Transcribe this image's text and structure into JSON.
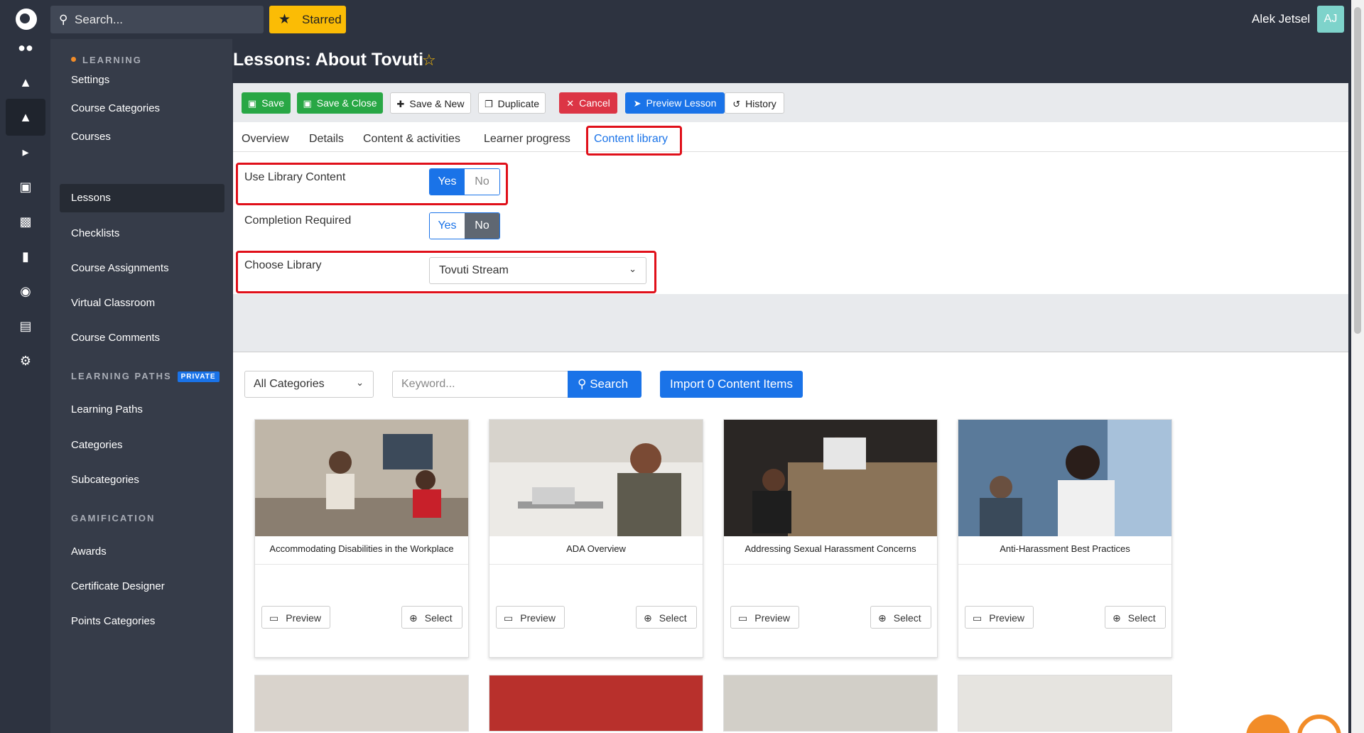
{
  "topbar": {
    "search_placeholder": "Search...",
    "starred_label": "Starred",
    "user_name": "Alek Jetsel",
    "avatar_initials": "AJ"
  },
  "rail": [
    "users-icon",
    "shapes-icon",
    "graduation-cap-icon",
    "megaphone-icon",
    "money-icon",
    "chart-icon",
    "chat-icon",
    "palette-icon",
    "calendar-icon",
    "gear-icon"
  ],
  "sidebar": {
    "heading_learning": "LEARNING",
    "learning_items": [
      "Settings",
      "Course Categories",
      "Courses",
      "Lessons",
      "Checklists",
      "Course Assignments",
      "Virtual Classroom",
      "Course Comments"
    ],
    "heading_paths": "LEARNING PATHS",
    "private_badge": "PRIVATE",
    "paths_items": [
      "Learning Paths",
      "Categories",
      "Subcategories"
    ],
    "heading_gamification": "GAMIFICATION",
    "gamification_items": [
      "Awards",
      "Certificate Designer",
      "Points Categories"
    ]
  },
  "page": {
    "title": "Lessons: About Tovuti"
  },
  "toolbar": {
    "save": "Save",
    "save_close": "Save & Close",
    "save_new": "Save & New",
    "duplicate": "Duplicate",
    "cancel": "Cancel",
    "preview_lesson": "Preview Lesson",
    "history": "History"
  },
  "tabs": [
    "Overview",
    "Details",
    "Content & activities",
    "Learner progress",
    "Content library"
  ],
  "form": {
    "use_library_label": "Use Library Content",
    "completion_label": "Completion Required",
    "choose_library_label": "Choose Library",
    "yes": "Yes",
    "no": "No",
    "library_value": "Tovuti Stream"
  },
  "filters": {
    "category_value": "All Categories",
    "keyword_placeholder": "Keyword...",
    "search_label": "Search",
    "import_label": "Import 0 Content Items"
  },
  "cards": [
    {
      "title": "Accommodating Disabilities in the Workplace",
      "preview": "Preview",
      "select": "Select"
    },
    {
      "title": "ADA Overview",
      "preview": "Preview",
      "select": "Select"
    },
    {
      "title": "Addressing Sexual Harassment Concerns",
      "preview": "Preview",
      "select": "Select"
    },
    {
      "title": "Anti-Harassment Best Practices",
      "preview": "Preview",
      "select": "Select"
    }
  ],
  "colors": {
    "accent": "#1a73e8",
    "success": "#28a745",
    "danger": "#dc3545",
    "starred": "#fbbc05",
    "sidebar_bg": "#363c49",
    "highlight": "#e0101a"
  }
}
